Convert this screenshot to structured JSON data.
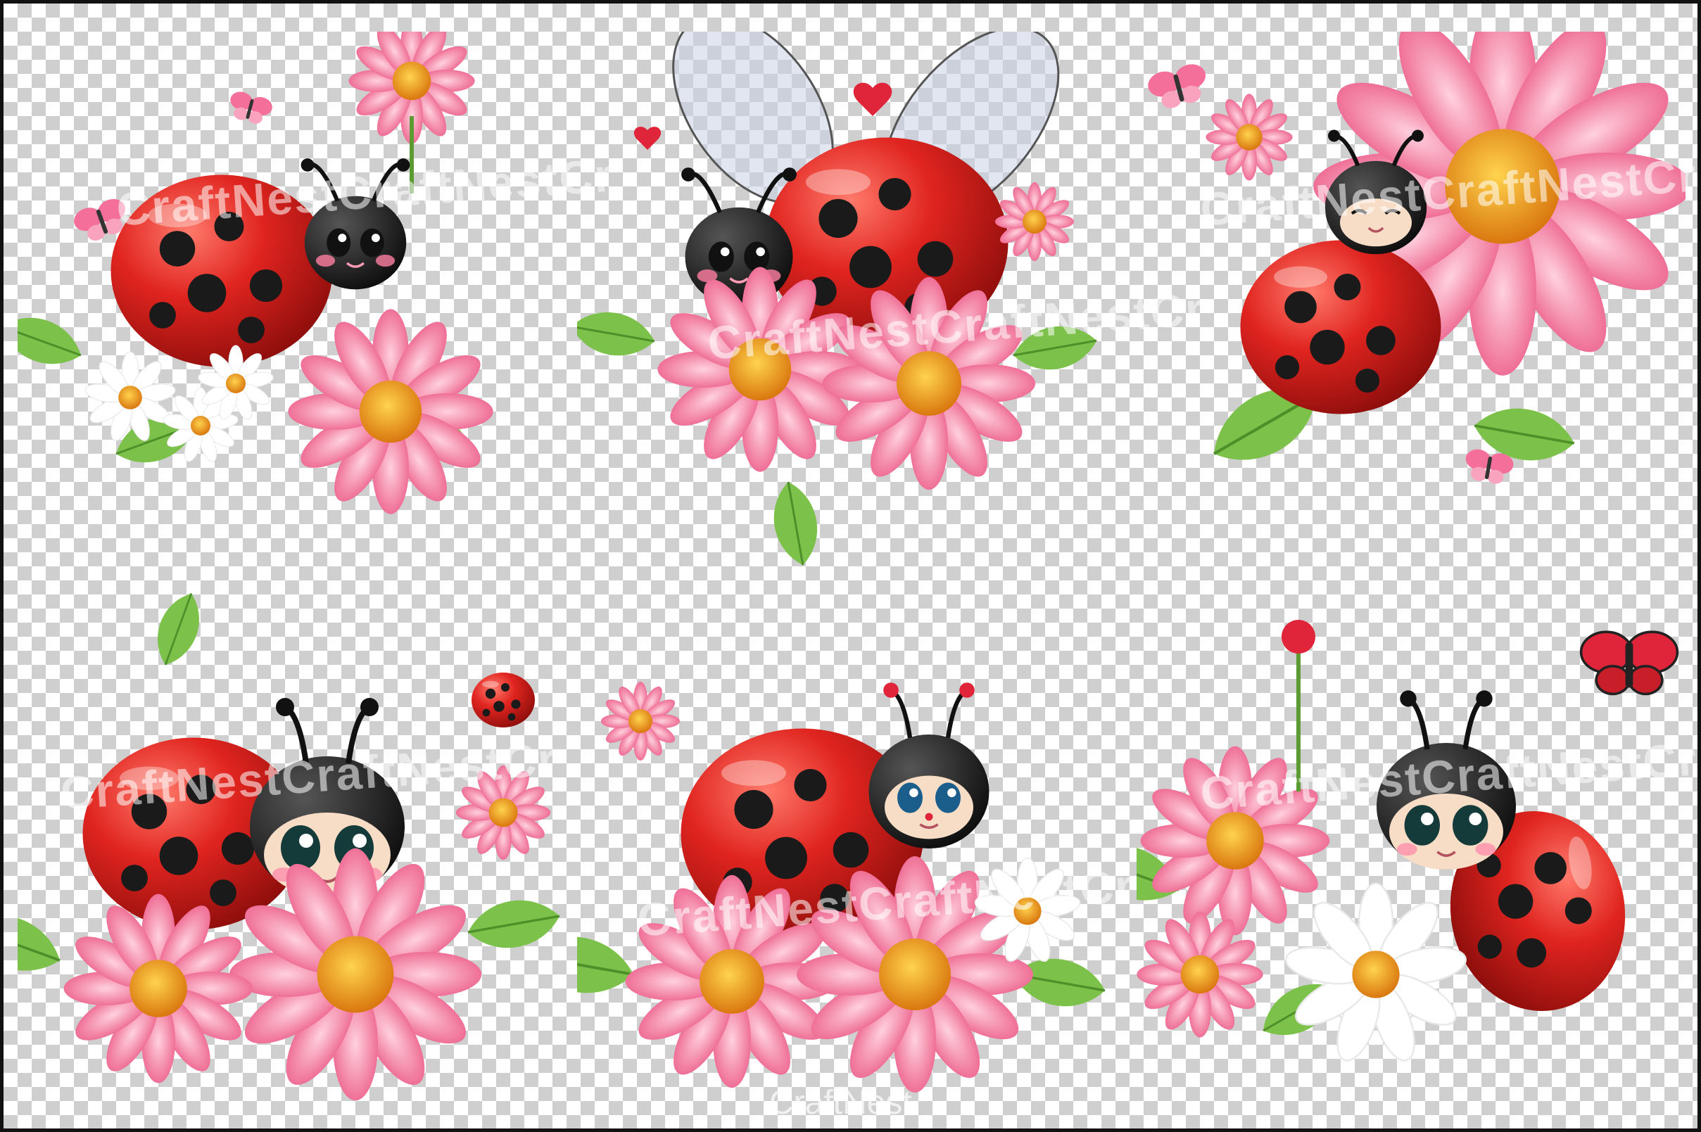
{
  "watermark": {
    "repeat_text": "CraftNestCraftNestCr",
    "bottom_text": "CraftNest"
  },
  "palette": {
    "ladybug_red": "#e0241f",
    "spot_black": "#1a1a1a",
    "petal_pink": "#f27fa3",
    "leaf_green": "#7cc24a",
    "center_yellow": "#f5a623",
    "checker_grey": "#cfcfcf"
  },
  "illustrations": [
    {
      "subject": "ladybug-on-pink-daisy"
    },
    {
      "subject": "flying-ladybug-on-pink-flowers"
    },
    {
      "subject": "smiling-ladybug-with-big-daisy"
    },
    {
      "subject": "cute-ladybug-big-eyes-on-flowers"
    },
    {
      "subject": "ladybug-blue-eyes-on-pink-daisies"
    },
    {
      "subject": "ladybug-with-white-daisy-and-butterfly"
    }
  ]
}
